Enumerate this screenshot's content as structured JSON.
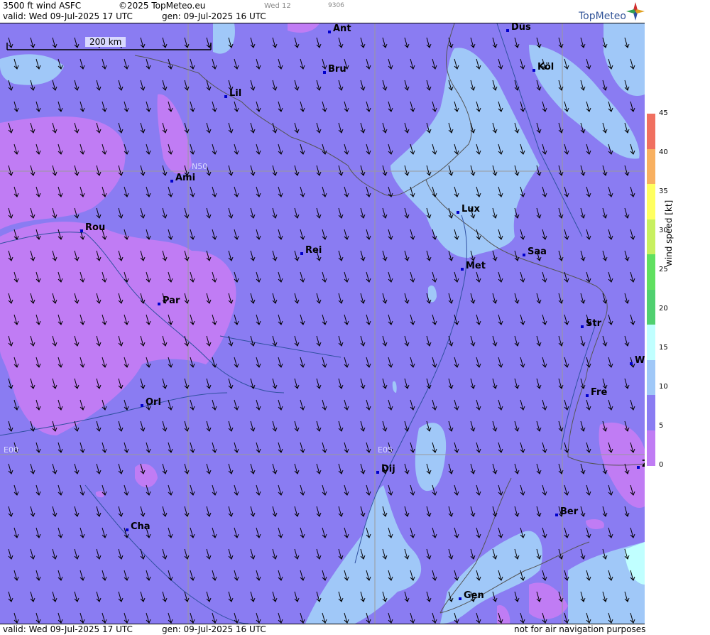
{
  "header": {
    "title": "3500 ft wind ASFC",
    "copyright": "©2025 TopMeteo.eu",
    "valid": "valid:  Wed  09-Jul-2025  17 UTC",
    "gen": "gen: 09-Jul-2025 16 UTC",
    "day_tab": "Wed 12",
    "code": "9306"
  },
  "logo": {
    "text": "TopMeteo"
  },
  "footer": {
    "valid": "valid:  Wed  09-Jul-2025  17 UTC",
    "gen": "gen: 09-Jul-2025 16 UTC",
    "disclaimer": "not for air navigation purposes"
  },
  "map": {
    "scale_label": "200 km",
    "grid_labels": [
      "N50",
      "E00",
      "E05"
    ],
    "cities": [
      {
        "name": "Ant"
      },
      {
        "name": "Düs"
      },
      {
        "name": "Bru"
      },
      {
        "name": "Köl"
      },
      {
        "name": "Lil"
      },
      {
        "name": "Ami"
      },
      {
        "name": "Rou"
      },
      {
        "name": "Lux"
      },
      {
        "name": "Rei"
      },
      {
        "name": "Saa"
      },
      {
        "name": "Met"
      },
      {
        "name": "Par"
      },
      {
        "name": "Str"
      },
      {
        "name": "W"
      },
      {
        "name": "Fre"
      },
      {
        "name": "Orl"
      },
      {
        "name": "Dij"
      },
      {
        "name": "Ber"
      },
      {
        "name": "Cha"
      },
      {
        "name": "Gen"
      },
      {
        "name": "Z"
      }
    ]
  },
  "legend": {
    "label": "wind speed [kt]",
    "ticks": [
      "45",
      "40",
      "35",
      "30",
      "25",
      "20",
      "15",
      "10",
      "5",
      "0"
    ],
    "colors": [
      "#f07060",
      "#f8b060",
      "#ffff60",
      "#c8f060",
      "#60e060",
      "#50d070",
      "#c0ffff",
      "#a0c8f8",
      "#8a7cf2",
      "#c07cf4"
    ]
  },
  "colors": {
    "wind_0_5": "#c07cf4",
    "wind_5_10": "#8a7cf2",
    "wind_10_15": "#a0c8f8",
    "wind_15_20": "#c0ffff"
  }
}
